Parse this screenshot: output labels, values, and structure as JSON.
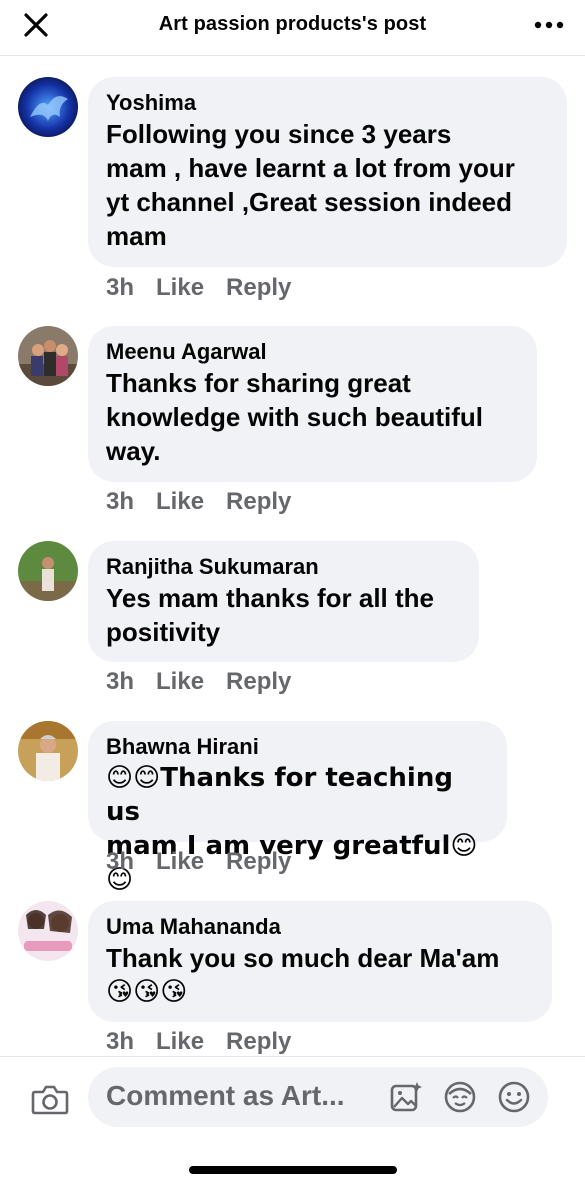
{
  "header": {
    "title": "Art passion products's post",
    "close_icon": "close-icon",
    "more_icon": "more-horizontal-icon"
  },
  "comments": [
    {
      "author": "Yoshima",
      "lines": [
        "Following you since 3 years",
        "mam , have learnt a lot from your",
        "yt channel ,Great session indeed",
        "mam"
      ],
      "time": "3h",
      "like": "Like",
      "reply": "Reply"
    },
    {
      "author": "Meenu Agarwal",
      "lines": [
        "Thanks for sharing great",
        "knowledge with such beautiful",
        "way."
      ],
      "time": "3h",
      "like": "Like",
      "reply": "Reply"
    },
    {
      "author": "Ranjitha Sukumaran",
      "lines": [
        "Yes mam thanks for all the",
        "positivity"
      ],
      "time": "3h",
      "like": "Like",
      "reply": "Reply"
    },
    {
      "author": "Bhawna Hirani",
      "lines": [
        "😊😊Thanks for teaching us",
        "mam I am very greatful😊😊"
      ],
      "time": "3h",
      "like": "Like",
      "reply": "Reply"
    },
    {
      "author": "Uma Mahananda",
      "lines": [
        "Thank you so much dear Ma'am",
        "😘😘😘"
      ],
      "time": "3h",
      "like": "Like",
      "reply": "Reply"
    }
  ],
  "composer": {
    "placeholder": "Comment as Art...",
    "camera_icon": "camera-icon",
    "gif_icon": "image-sparkle-icon",
    "avatar_icon": "avatar-sticker-icon",
    "emoji_icon": "emoji-icon"
  }
}
